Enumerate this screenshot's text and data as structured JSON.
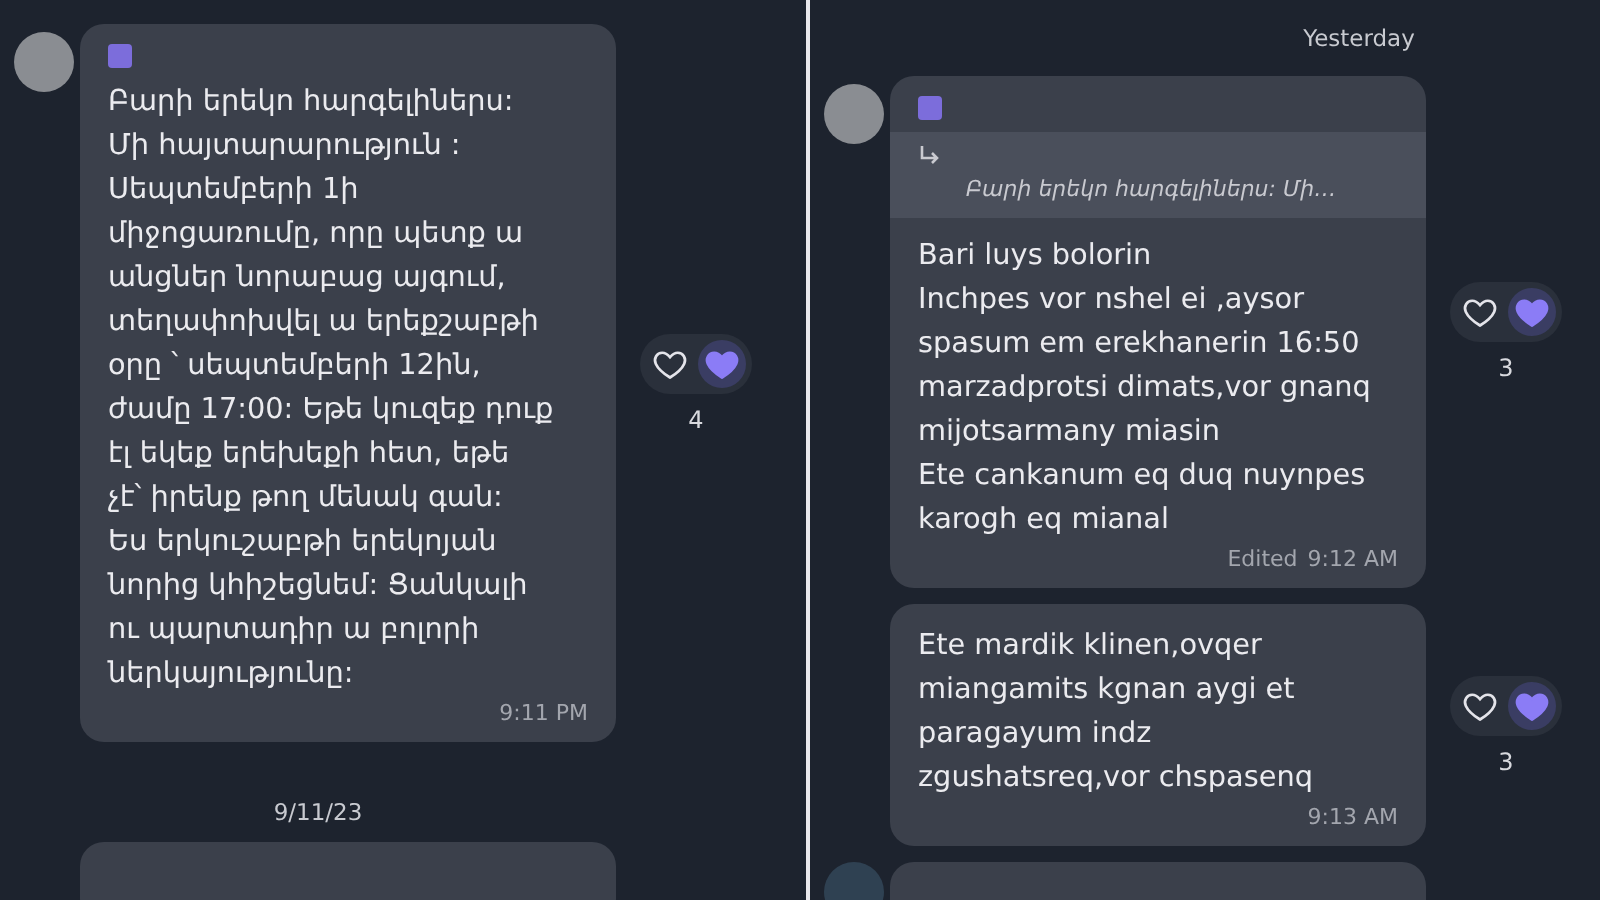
{
  "panels": [
    {
      "messages": [
        {
          "show_header": true,
          "text": "Բարի երեկո հարգելիներս:\nՄի հայտարարություն :\nՍեպտեմբերի 1ի\nմիջոցառումը, որը պետք ա\nանցներ նորաբաց այգում,\nտեղափոխվել ա երեքշաբթի\nօրը ՝ սեպտեմբերի 12ին,\nժամը 17:00:  Եթե կուզեք դուք\nէլ եկեք երեխեքի հետ, եթե\nչէ՝ իրենք թող մենակ գան:\nԵս երկուշաբթի երեկոյան\nնորից կհիշեցնեմ: Ցանկալի\nու պարտադիր ա բոլորի\nներկայությունը:",
          "time": "9:11 PM",
          "reactions": {
            "reacted": true,
            "count": "4"
          }
        }
      ],
      "after_divider": "9/11/23"
    },
    {
      "divider": "Yesterday",
      "messages": [
        {
          "show_header": true,
          "reply": {
            "text": "Բարի երեկո հարգելիներս: Մի…"
          },
          "text": "Bari luys bolorin\nInchpes vor nshel ei ,aysor\nspasum em erekhanerin 16:50\nmarzadprotsi dimats,vor gnanq\nmijotsarmany miasin\nEte cankanum eq duq nuynpes\nkarogh eq mianal",
          "edited": "Edited",
          "time": "9:12 AM",
          "reactions": {
            "reacted": true,
            "count": "3"
          }
        },
        {
          "show_header": false,
          "text": "Ete mardik klinen,ovqer\nmiangamits kgnan aygi et\nparagayum indz\nzgushatsreq,vor chspasenq",
          "time": "9:13 AM",
          "reactions": {
            "reacted": true,
            "count": "3"
          }
        }
      ]
    }
  ]
}
